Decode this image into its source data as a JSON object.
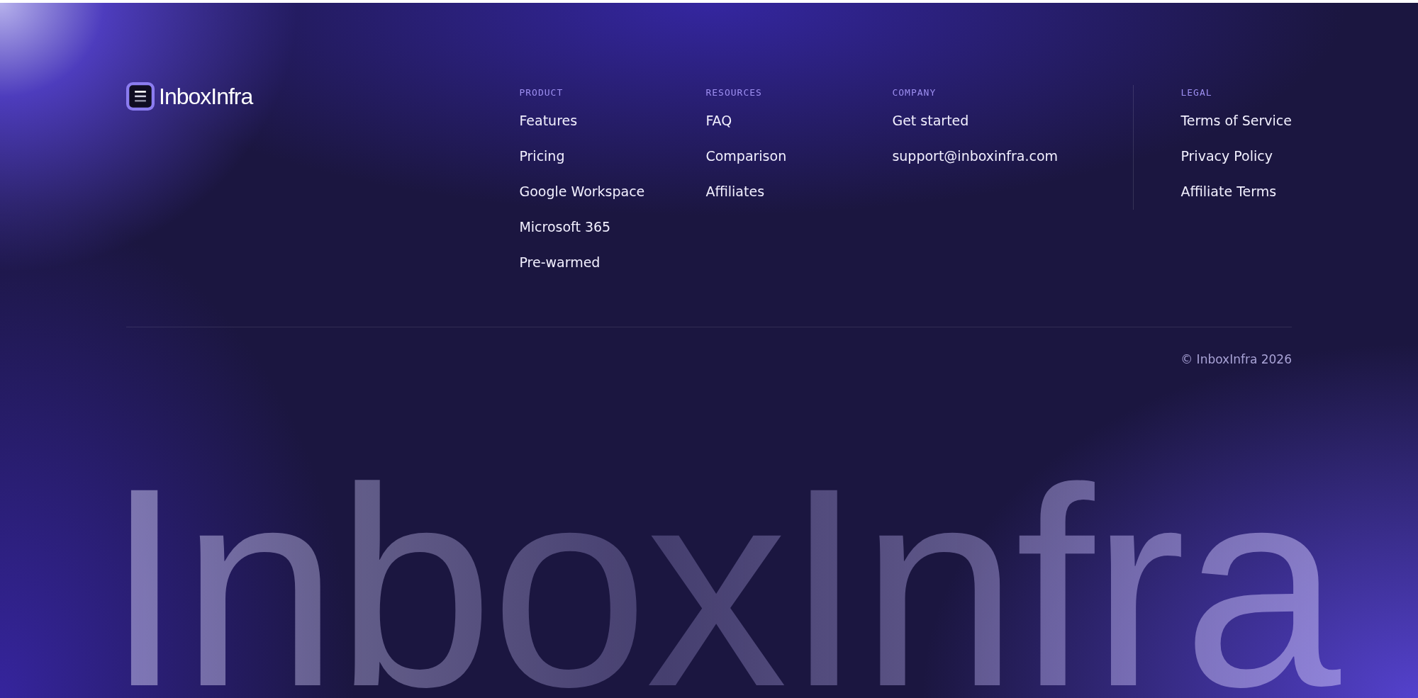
{
  "brand": {
    "name": "InboxInfra"
  },
  "columns": [
    {
      "heading": "PRODUCT",
      "links": [
        "Features",
        "Pricing",
        "Google Workspace",
        "Microsoft 365",
        "Pre-warmed"
      ]
    },
    {
      "heading": "RESOURCES",
      "links": [
        "FAQ",
        "Comparison",
        "Affiliates"
      ]
    },
    {
      "heading": "COMPANY",
      "links": [
        "Get started",
        "support@inboxinfra.com"
      ]
    },
    {
      "heading": "LEGAL",
      "links": [
        "Terms of Service",
        "Privacy Policy",
        "Affiliate Terms"
      ]
    }
  ],
  "copyright": "© InboxInfra 2026",
  "wordmark": "InboxInfra"
}
